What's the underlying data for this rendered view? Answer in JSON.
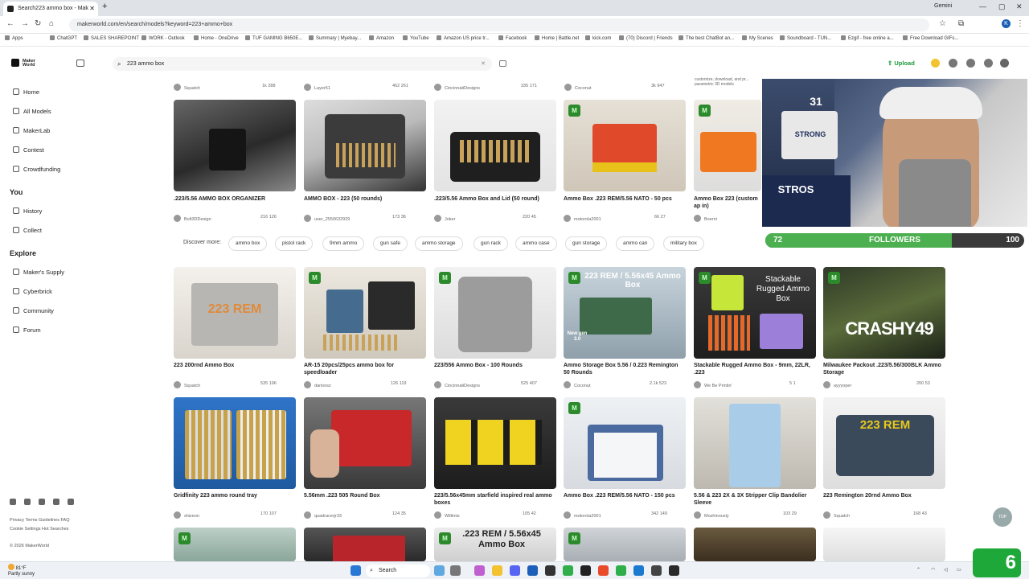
{
  "browser": {
    "tab_title": "Search223 ammo box - Mak",
    "new_tab": "+",
    "profile_label": "Gemini",
    "url": "makerworld.com/en/search/models?keyword=223+ammo+box",
    "bookmarks": [
      "Apps",
      "ChatGPT",
      "SALES SHAREPOINT",
      "WORK - Outlook",
      "Home - OneDrive",
      "TUF GAMING B650E...",
      "Summary | Myebay...",
      "Amazon",
      "YouTube",
      "Amazon US price tr...",
      "Facebook",
      "Home | Battle.net",
      "kick.com",
      "(70) Discord | Friends",
      "The best ChatBot an...",
      "My Scenes",
      "Soundboard - TUN...",
      "Ezgif - free online a...",
      "Free Download GIFs..."
    ]
  },
  "sidebar": {
    "logo": "Maker World",
    "items": [
      "Home",
      "All Models",
      "MakerLab",
      "Contest",
      "Crowdfunding"
    ],
    "you_heading": "You",
    "you_items": [
      "History",
      "Collect"
    ],
    "explore_heading": "Explore",
    "explore_items": [
      "Maker's Supply",
      "Cyberbrick",
      "Community",
      "Forum"
    ],
    "footer_links_1": "Privacy   Terms   Guidelines   FAQ",
    "footer_links_2": "Cookie Settings   Hot Searches",
    "copyright": "© 2026 MakerWorld"
  },
  "topbar": {
    "search_value": "223 ammo box",
    "upload_label": "Upload"
  },
  "top_row_stats": [
    {
      "author": "Squatch",
      "stats": "1k   288"
    },
    {
      "author": "Layer51",
      "stats": "462   261"
    },
    {
      "author": "CincinnatiDesigns",
      "stats": "335   171"
    },
    {
      "author": "Coconut",
      "stats": "3k   947"
    },
    {
      "author": "customize, download, and pr... parametric 3D models",
      "stats": ""
    }
  ],
  "row1": [
    {
      "title": ".223/5.56 AMMO BOX ORGANIZER",
      "author": "Bolt3DDesign",
      "stats": "216   126"
    },
    {
      "title": "AMMO BOX - 223 (50 rounds)",
      "author": "user_2550632929",
      "stats": "173   36"
    },
    {
      "title": ".223/5.56 Ammo Box and Lid (50 round)",
      "author": "Joker",
      "stats": "220   45"
    },
    {
      "title": "Ammo Box .223 REM/5.56 NATO - 50 pcs",
      "author": "motorola2001",
      "stats": "66   27"
    },
    {
      "title": "Ammo Box 223 (custom ap in)",
      "author": "Boerni",
      "stats": ""
    }
  ],
  "discover": {
    "label": "Discover more:",
    "chips": [
      "ammo box",
      "pistol rack",
      "9mm ammo",
      "gun safe",
      "ammo storage",
      "gun rack",
      "ammo case",
      "gun storage",
      "ammo can",
      "military box"
    ]
  },
  "row2": [
    {
      "title": "223 200rnd Ammo Box",
      "author": "Squatch",
      "stats": "535   196",
      "overlay": "223 REM"
    },
    {
      "title": "AR-15 20pcs/25pcs ammo box for speedloader",
      "author": "darioosz",
      "stats": "126   119",
      "overlay": ""
    },
    {
      "title": "223/556 Ammo Box - 100 Rounds",
      "author": "CincinnatiDesigns",
      "stats": "525   407",
      "overlay": ""
    },
    {
      "title": "Ammo Storage Box 5.56 / 0.223 Remington 50 Rounds",
      "author": "Coconut",
      "stats": "2.1k   523",
      "overlay": "223 REM / 5.56x45 Ammo Box",
      "overlay2": "New gen 3.0"
    },
    {
      "title": "Stackable Rugged Ammo Box - 9mm, 22LR, .223",
      "author": "We Be Printin'",
      "stats": "5   1",
      "overlay": "Stackable Rugged Ammo Box"
    },
    {
      "title": "Milwaukee Packout .223/5.56/300BLK Ammo Storage",
      "author": "ayyyoper",
      "stats": "200   53",
      "overlay": "CRASHY49"
    }
  ],
  "row3": [
    {
      "title": "Gridfinity 223 ammo round tray",
      "author": "shizeon",
      "stats": "170   107"
    },
    {
      "title": "5.56mm .223 505 Round Box",
      "author": "quadracerjr33",
      "stats": "124   35"
    },
    {
      "title": "223/5.56x45mm starfield inspired real ammo boxes",
      "author": "Willimis",
      "stats": "105   42"
    },
    {
      "title": "Ammo Box .223 REM/5.56 NATO - 150 pcs",
      "author": "motorola2001",
      "stats": "342   149"
    },
    {
      "title": "5.56 & 223 2X & 3X Stripper Clip Bandolier Sleeve",
      "author": "Moshinously",
      "stats": "103   29"
    },
    {
      "title": "223 Remington 20rnd Ammo Box",
      "author": "Squatch",
      "stats": "168   43",
      "overlay": "223 REM"
    }
  ],
  "row4_overlay": ".223 REM / 5.56x45 Ammo Box",
  "overlay_stream": {
    "followers_label": "FOLLOWERS",
    "followers_current": "72",
    "followers_goal": "100",
    "followers_fraction": 0.72,
    "cap_text": "STROS",
    "jersey_text": "STRONG",
    "jersey_number": "31"
  },
  "back_to_top": "TOP",
  "taskbar": {
    "weather_temp": "81°F",
    "weather_desc": "Partly sunny",
    "search_label": "Search",
    "stream_badge": "6"
  }
}
